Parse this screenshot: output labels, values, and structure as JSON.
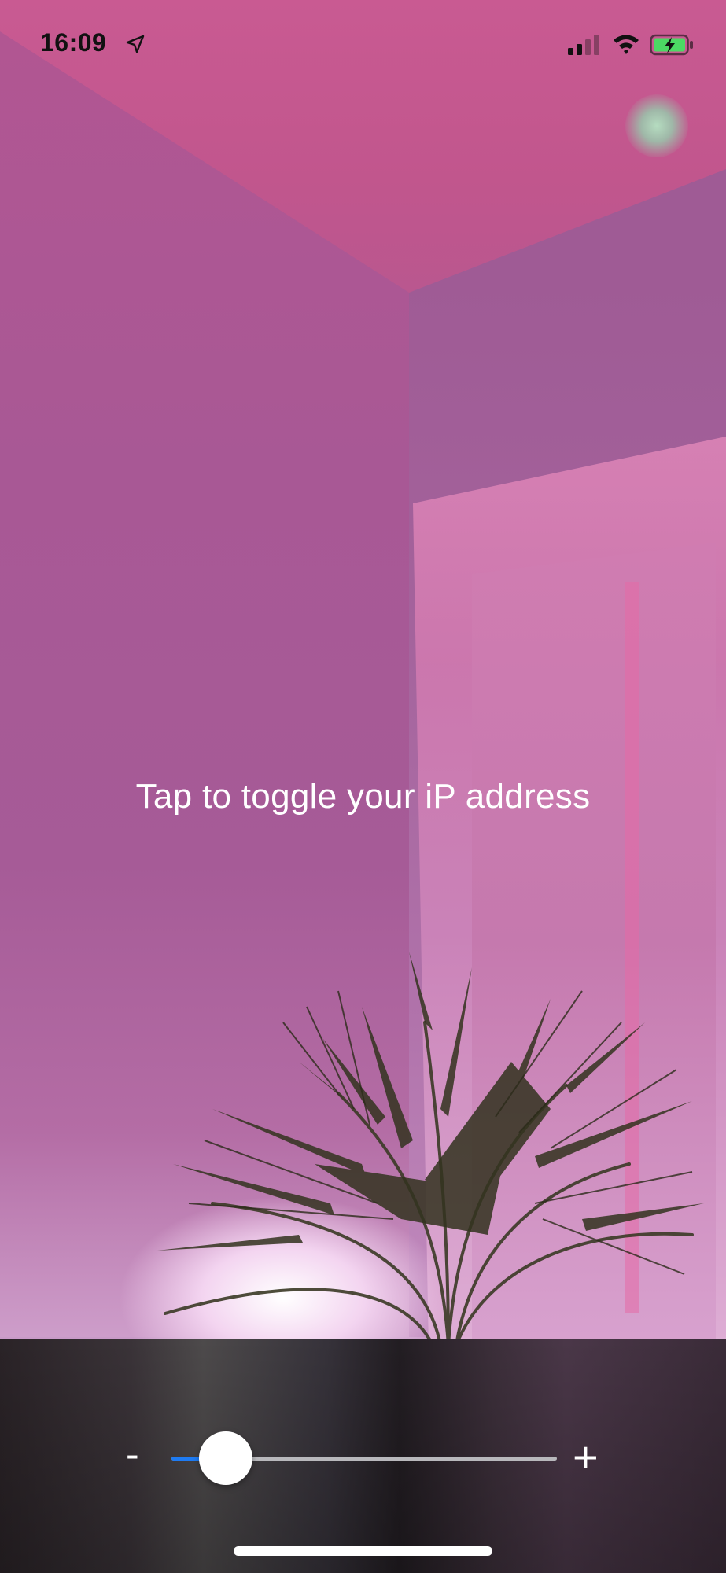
{
  "status_bar": {
    "time": "16:09",
    "location_icon": "location-arrow-icon",
    "signal_icon": "cellular-signal-icon",
    "wifi_icon": "wifi-icon",
    "battery_icon": "battery-charging-icon",
    "battery_color": "#4cd964"
  },
  "main": {
    "tap_label": "Tap to toggle your iP address"
  },
  "controls": {
    "minus_label": "-",
    "plus_label": "+",
    "slider_value": 0.1,
    "accent_color": "#1e7bf2"
  }
}
